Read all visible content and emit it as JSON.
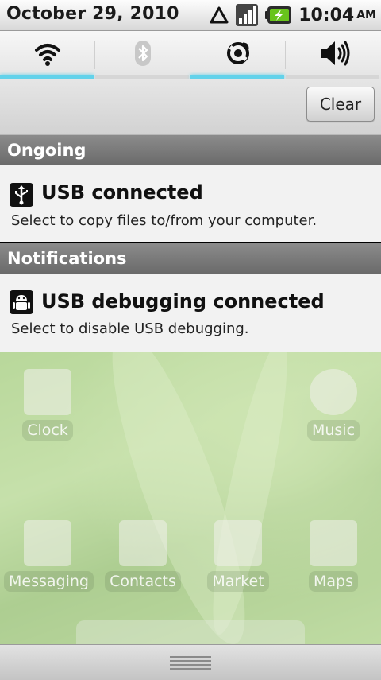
{
  "status_bar": {
    "date": "October 29, 2010",
    "time": "10:04",
    "ampm": "AM",
    "icons": [
      "warning-triangle-icon",
      "signal-icon",
      "battery-charging-icon"
    ]
  },
  "power_widget": {
    "toggles": [
      {
        "name": "wifi",
        "icon": "wifi-icon",
        "enabled": true
      },
      {
        "name": "bluetooth",
        "icon": "bluetooth-icon",
        "enabled": false
      },
      {
        "name": "gps",
        "icon": "gps-icon",
        "enabled": true
      },
      {
        "name": "sound",
        "icon": "volume-icon",
        "enabled": false
      }
    ]
  },
  "header": {
    "clear_label": "Clear"
  },
  "sections": {
    "ongoing": "Ongoing",
    "notifications": "Notifications"
  },
  "ongoing_item": {
    "icon": "usb-icon",
    "title": "USB connected",
    "subtitle": "Select to copy files to/from your computer."
  },
  "notification_item": {
    "icon": "android-debug-icon",
    "title": "USB debugging connected",
    "subtitle": "Select to disable USB debugging."
  },
  "home_apps": [
    {
      "label": "Clock"
    },
    {
      "label": "Music"
    },
    {
      "label": "Messaging"
    },
    {
      "label": "Contacts"
    },
    {
      "label": "Market"
    },
    {
      "label": "Maps"
    }
  ],
  "colors": {
    "toggle_on": "#63d2ea",
    "section_header": "#7a7a7a",
    "notification_bg": "#f2f2f2"
  }
}
